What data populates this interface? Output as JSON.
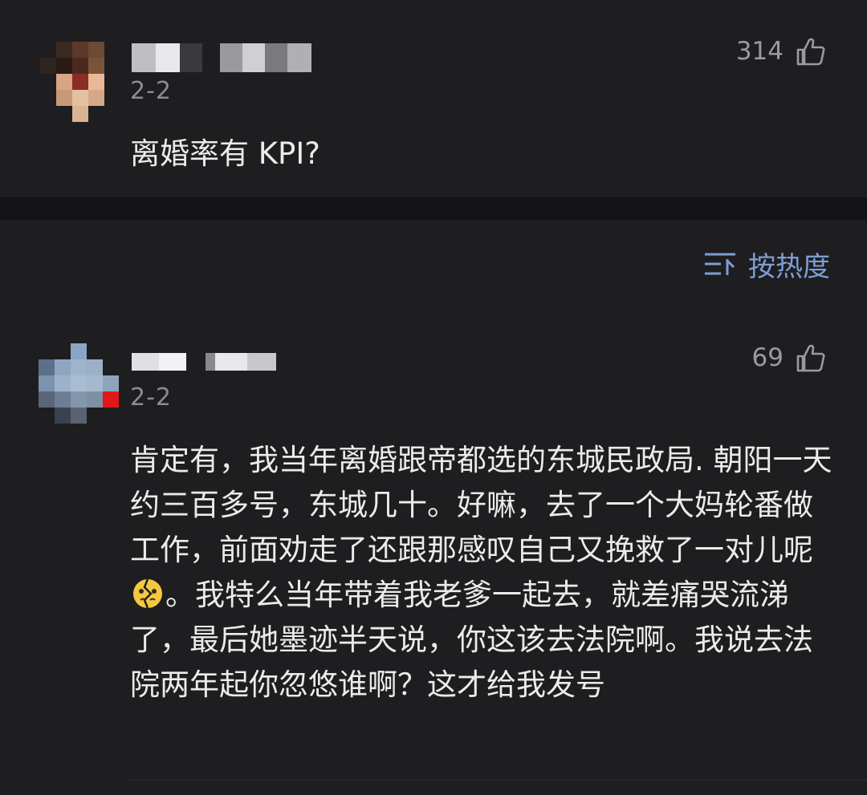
{
  "comments": [
    {
      "date": "2-2",
      "likes": "314",
      "text": "离婚率有 KPI?"
    },
    {
      "date": "2-2",
      "likes": "69",
      "text_before_emoji": "肯定有，我当年离婚跟帝都选的东城民政局. 朝阳一天约三百多号，东城几十。好嘛，去了一个大妈轮番做工作，前面劝走了还跟那感叹自己又挽救了一对儿呢",
      "text_after_emoji": "。我特么当年带着我老爹一起去，就差痛哭流涕了，最后她墨迹半天说，你这该去法院啊。我说去法院两年起你忽悠谁啊？这才给我发号"
    }
  ],
  "sort": {
    "label": "按热度",
    "icon": "sort-icon"
  },
  "icons": {
    "like": "thumbs-up-icon",
    "emoji": "broken-face-emoji"
  },
  "colors": {
    "background": "#1e1e20",
    "accent": "#7c9ed6",
    "muted": "#8c8c8e"
  }
}
